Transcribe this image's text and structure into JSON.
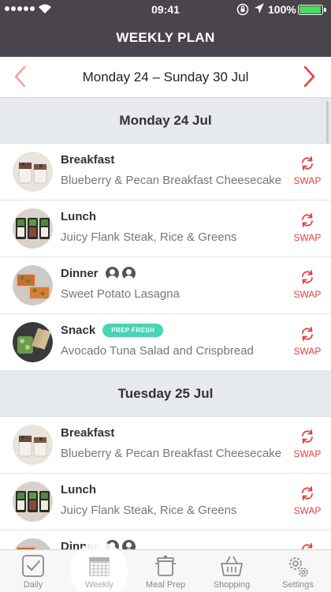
{
  "status_bar": {
    "time": "09:41",
    "battery": "100%",
    "battery_level": 1.0
  },
  "header": {
    "title": "WEEKLY PLAN"
  },
  "week": {
    "range": "Monday 24 – Sunday 30 Jul"
  },
  "swap_label": "SWAP",
  "days": [
    {
      "title": "Monday 24 Jul",
      "meals": [
        {
          "type": "Breakfast",
          "name": "Blueberry & Pecan Breakfast Cheesecake"
        },
        {
          "type": "Lunch",
          "name": "Juicy Flank Steak, Rice & Greens"
        },
        {
          "type": "Dinner",
          "name": "Sweet Potato Lasagna",
          "people_icons": 2
        },
        {
          "type": "Snack",
          "name": "Avocado Tuna Salad and Crispbread",
          "tag": "PREP FRESH"
        }
      ]
    },
    {
      "title": "Tuesday 25 Jul",
      "meals": [
        {
          "type": "Breakfast",
          "name": "Blueberry & Pecan Breakfast Cheesecake"
        },
        {
          "type": "Lunch",
          "name": "Juicy Flank Steak, Rice & Greens"
        },
        {
          "type": "Dinner",
          "name": "",
          "people_icons": 2
        }
      ]
    }
  ],
  "tabs": [
    {
      "label": "Daily",
      "icon": "check-icon"
    },
    {
      "label": "Weekly",
      "icon": "calendar-icon",
      "active": true
    },
    {
      "label": "Meal Prep",
      "icon": "pot-icon"
    },
    {
      "label": "Shopping",
      "icon": "basket-icon"
    },
    {
      "label": "Settings",
      "icon": "gears-icon"
    }
  ],
  "colors": {
    "header_bg": "#4a454c",
    "accent_red": "#e43d3d",
    "tag_teal": "#47d3b5",
    "day_header_bg": "#e6e9ed"
  }
}
